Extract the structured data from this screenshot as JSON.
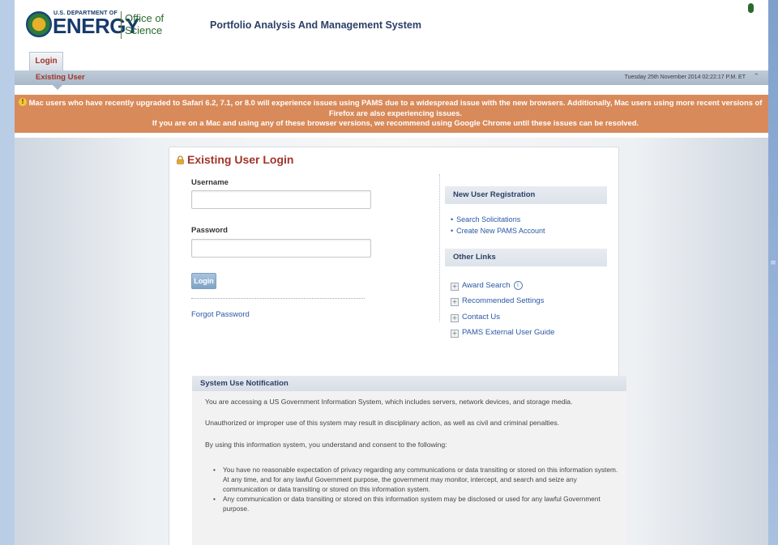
{
  "header": {
    "logo_dept": "U.S. DEPARTMENT OF",
    "logo_energy": "ENERGY",
    "logo_office": "Office of Science",
    "app_title": "Portfolio Analysis And Management System"
  },
  "tabs": [
    {
      "label": "Login"
    }
  ],
  "subnav": {
    "label": "Existing User",
    "datetime": "Tuesday 25th November 2014 02:22:17 P.M. ET"
  },
  "banner": {
    "line1": "Mac users who have recently upgraded to Safari 6.2, 7.1, or 8.0 will experience issues using PAMS due to a widespread issue with the new browsers. Additionally, Mac users using more recent versions of Firefox are also experiencing issues.",
    "line2": "If you are on a Mac and using any of these browser versions, we recommend using Google Chrome until these issues can be resolved."
  },
  "login": {
    "title": "Existing User Login",
    "username_label": "Username",
    "username_value": "",
    "password_label": "Password",
    "password_value": "",
    "login_button": "Login",
    "forgot_password": "Forgot Password"
  },
  "new_user": {
    "heading": "New User Registration",
    "links": [
      "Search Solicitations",
      "Create New PAMS Account"
    ]
  },
  "other_links": {
    "heading": "Other Links",
    "links": [
      "Award Search",
      "Recommended Settings",
      "Contact Us",
      "PAMS External User Guide"
    ]
  },
  "notice": {
    "heading": "System Use Notification",
    "p1": "You are accessing a US Government Information System, which includes servers, network devices, and storage media.",
    "p2": "Unauthorized or improper use of this system may result in disciplinary action, as well as civil and criminal penalties.",
    "p3": "By using this information system, you understand and consent to the following:",
    "bullets": [
      "You have no reasonable expectation of privacy regarding any communications or data transiting or stored on this information system. At any time, and for any lawful Government purpose, the government may monitor, intercept, and search and seize any communication or data transiting or stored on this information system.",
      "Any communication or data transiting or stored on this information system may be disclosed or used for any lawful Government purpose."
    ]
  },
  "colors": {
    "accent_red": "#a2342a",
    "link_blue": "#2b58a6",
    "banner_orange": "#d98a5a",
    "nav_blue": "#2b3f66"
  },
  "icons": {
    "lock": "lock-icon",
    "info": "info-icon",
    "warning": "warning-icon",
    "collapse": "collapse-icon",
    "expand": "plus-icon"
  }
}
